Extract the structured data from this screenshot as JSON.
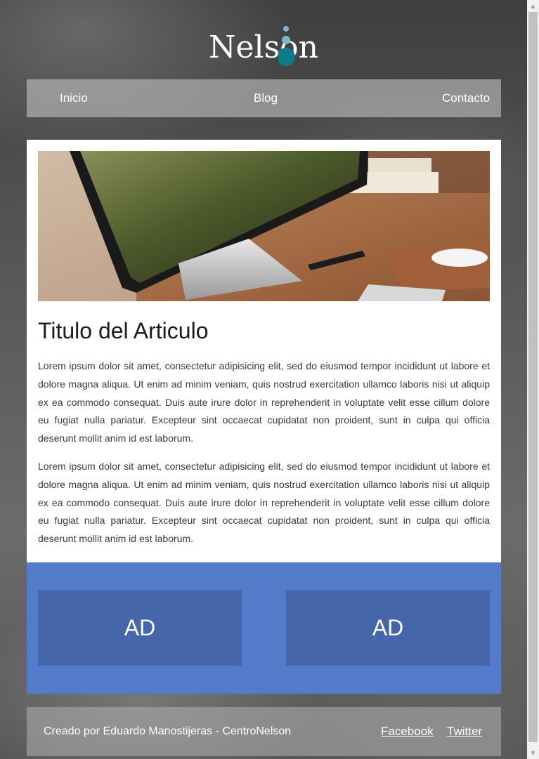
{
  "brand": {
    "logo_text": "Nelson",
    "accent_color": "#0e7a8a",
    "dot_color": "#7fb6c7"
  },
  "nav": {
    "items": [
      {
        "label": "Inicio"
      },
      {
        "label": "Blog"
      },
      {
        "label": "Contacto"
      }
    ]
  },
  "article": {
    "image_description_icon": "desk-computer-photo",
    "title": "Titulo del Articulo",
    "paragraphs": [
      "Lorem ipsum dolor sit amet, consectetur adipisicing elit, sed do eiusmod tempor incididunt ut labore et dolore magna aliqua. Ut enim ad minim veniam, quis nostrud exercitation ullamco laboris nisi ut aliquip ex ea commodo consequat. Duis aute irure dolor in reprehenderit in voluptate velit esse cillum dolore eu fugiat nulla pariatur. Excepteur sint occaecat cupidatat non proident, sunt in culpa qui officia deserunt mollit anim id est laborum.",
      "Lorem ipsum dolor sit amet, consectetur adipisicing elit, sed do eiusmod tempor incididunt ut labore et dolore magna aliqua. Ut enim ad minim veniam, quis nostrud exercitation ullamco laboris nisi ut aliquip ex ea commodo consequat. Duis aute irure dolor in reprehenderit in voluptate velit esse cillum dolore eu fugiat nulla pariatur. Excepteur sint occaecat cupidatat non proident, sunt in culpa qui officia deserunt mollit anim id est laborum."
    ]
  },
  "ads": {
    "left_label": "AD",
    "right_label": "AD",
    "band_color": "#527cca",
    "box_color": "#4566a8"
  },
  "footer": {
    "credit": "Creado por Eduardo Manostijeras - CentroNelson",
    "links": [
      {
        "label": "Facebook"
      },
      {
        "label": "Twitter"
      }
    ]
  },
  "scrollbar": {
    "up_icon": "triangle-up-icon",
    "down_icon": "triangle-down-icon"
  }
}
